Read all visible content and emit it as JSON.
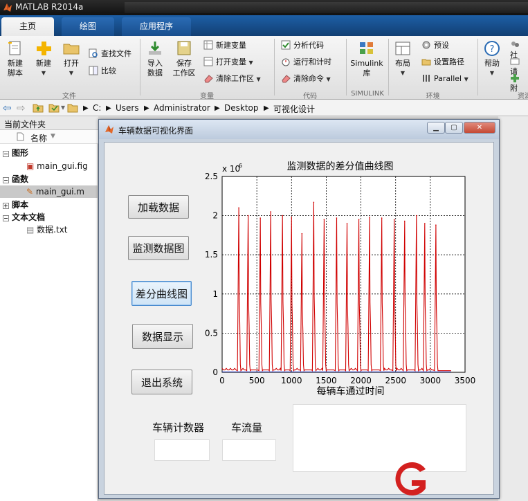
{
  "window": {
    "title": "MATLAB R2014a"
  },
  "tabs": [
    {
      "label": "主页"
    },
    {
      "label": "绘图"
    },
    {
      "label": "应用程序"
    }
  ],
  "ribbon": {
    "new_script": "新建\n脚本",
    "new": "新建",
    "open": "打开",
    "find_files": "查找文件",
    "compare": "比较",
    "group_file": "文件",
    "import_data": "导入\n数据",
    "save_workspace": "保存\n工作区",
    "new_variable": "新建变量",
    "open_variable": "打开变量",
    "clear_workspace": "清除工作区",
    "group_variable": "变量",
    "analyze_code": "分析代码",
    "run_and_time": "运行和计时",
    "clear_commands": "清除命令",
    "group_code": "代码",
    "simulink_lib": "Simulink\n库",
    "group_simulink": "SIMULINK",
    "layout": "布局",
    "preferences": "预设",
    "set_path": "设置路径",
    "parallel": "Parallel",
    "group_env": "环境",
    "help": "帮助",
    "community": "社",
    "request": "请",
    "addons": "附",
    "group_resources": "资源"
  },
  "address": {
    "crumbs": [
      "C:",
      "Users",
      "Administrator",
      "Desktop",
      "可视化设计"
    ]
  },
  "file_panel": {
    "title": "当前文件夹",
    "column": "名称",
    "tree": [
      {
        "type": "group",
        "label": "图形"
      },
      {
        "type": "file",
        "label": "main_gui.fig"
      },
      {
        "type": "group",
        "label": "函数"
      },
      {
        "type": "file",
        "label": "main_gui.m",
        "selected": true
      },
      {
        "type": "group",
        "label": "脚本"
      },
      {
        "type": "group",
        "label": "文本文档"
      },
      {
        "type": "file",
        "label": "数据.txt"
      }
    ]
  },
  "gui": {
    "title": "车辆数据可视化界面",
    "buttons": {
      "load": "加载数据",
      "monitor": "监测数据图",
      "diff": "差分曲线图",
      "display": "数据显示",
      "exit": "退出系统"
    },
    "labels": {
      "vehicle_counter": "车辆计数器",
      "traffic_flow": "车流量"
    }
  },
  "chart_data": {
    "type": "line",
    "title": "监测数据的差分值曲线图",
    "xlabel": "每辆车通过时间",
    "ylabel": "",
    "y_exponent_label": "x 10",
    "y_exponent_power": "6",
    "xlim": [
      0,
      3500
    ],
    "ylim": [
      0,
      2.5
    ],
    "xticks": [
      "0",
      "500",
      "1000",
      "1500",
      "2000",
      "2500",
      "3000",
      "3500"
    ],
    "yticks": [
      "0",
      "0.5",
      "1",
      "1.5",
      "2",
      "2.5"
    ],
    "grid": true,
    "series": [
      {
        "color": "#d00000",
        "peaks": [
          {
            "x": 240,
            "y": 2.1
          },
          {
            "x": 375,
            "y": 2.0
          },
          {
            "x": 550,
            "y": 1.97
          },
          {
            "x": 700,
            "y": 2.05
          },
          {
            "x": 870,
            "y": 2.0
          },
          {
            "x": 1000,
            "y": 1.98
          },
          {
            "x": 1150,
            "y": 1.77
          },
          {
            "x": 1320,
            "y": 2.17
          },
          {
            "x": 1470,
            "y": 1.95
          },
          {
            "x": 1650,
            "y": 1.97
          },
          {
            "x": 1800,
            "y": 1.9
          },
          {
            "x": 1970,
            "y": 1.95
          },
          {
            "x": 2125,
            "y": 1.98
          },
          {
            "x": 2300,
            "y": 1.97
          },
          {
            "x": 2480,
            "y": 1.95
          },
          {
            "x": 2630,
            "y": 1.93
          },
          {
            "x": 2800,
            "y": 2.0
          },
          {
            "x": 2920,
            "y": 1.9
          },
          {
            "x": 3080,
            "y": 1.88
          }
        ],
        "x_end": 3300
      }
    ]
  }
}
